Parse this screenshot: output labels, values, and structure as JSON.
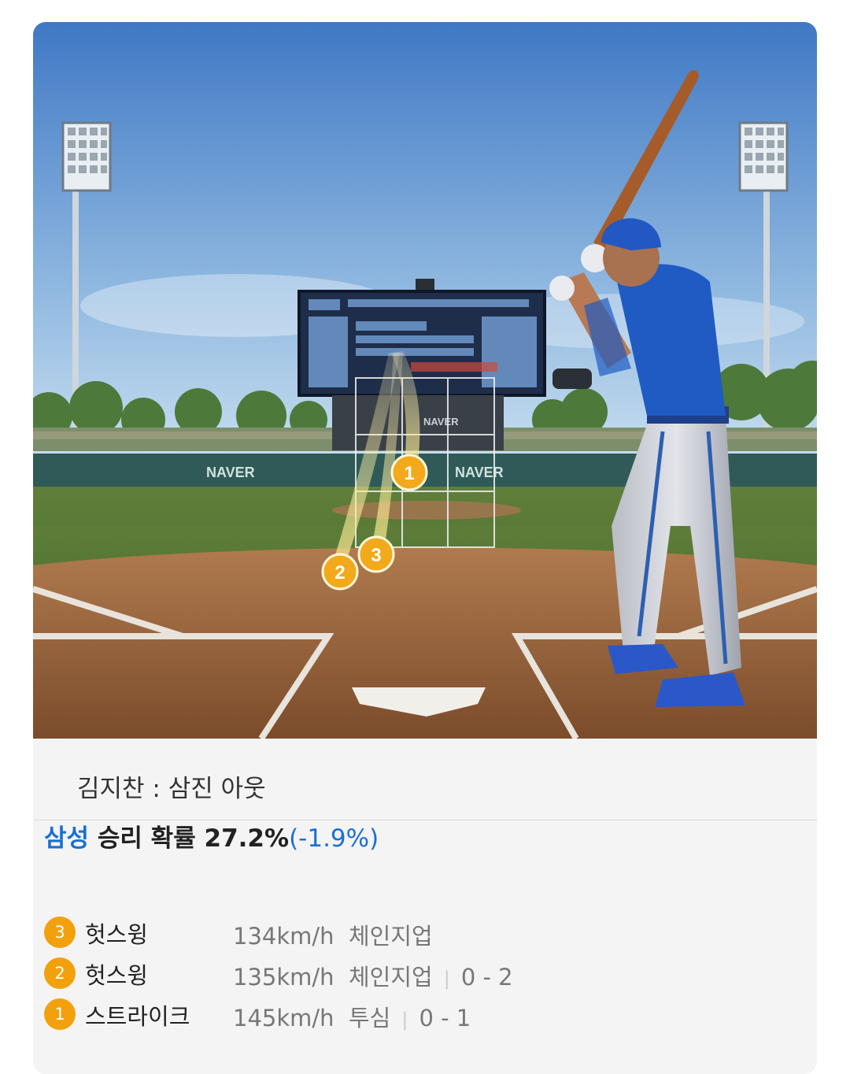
{
  "scene": {
    "wall_text_1": "NAVER",
    "wall_text_2": "NAVER",
    "scoreboard_text": "NAVER",
    "pitches_on_field": [
      "1",
      "2",
      "3"
    ]
  },
  "caption": "김지찬 : 삼진 아웃",
  "probability": {
    "team": "삼성",
    "label": " 승리 확률 ",
    "value": "27.2%",
    "delta": "(-1.9%)"
  },
  "pitches": [
    {
      "num": "3",
      "result": "헛스윙",
      "speed": "134km/h",
      "type": "체인지업",
      "count": ""
    },
    {
      "num": "2",
      "result": "헛스윙",
      "speed": "135km/h",
      "type": "체인지업",
      "count": "0 - 2"
    },
    {
      "num": "1",
      "result": "스트라이크",
      "speed": "145km/h",
      "type": "투심",
      "count": "0 - 1"
    }
  ],
  "colors": {
    "accent_blue": "#1a6fd1",
    "badge_orange": "#f2a10d"
  }
}
